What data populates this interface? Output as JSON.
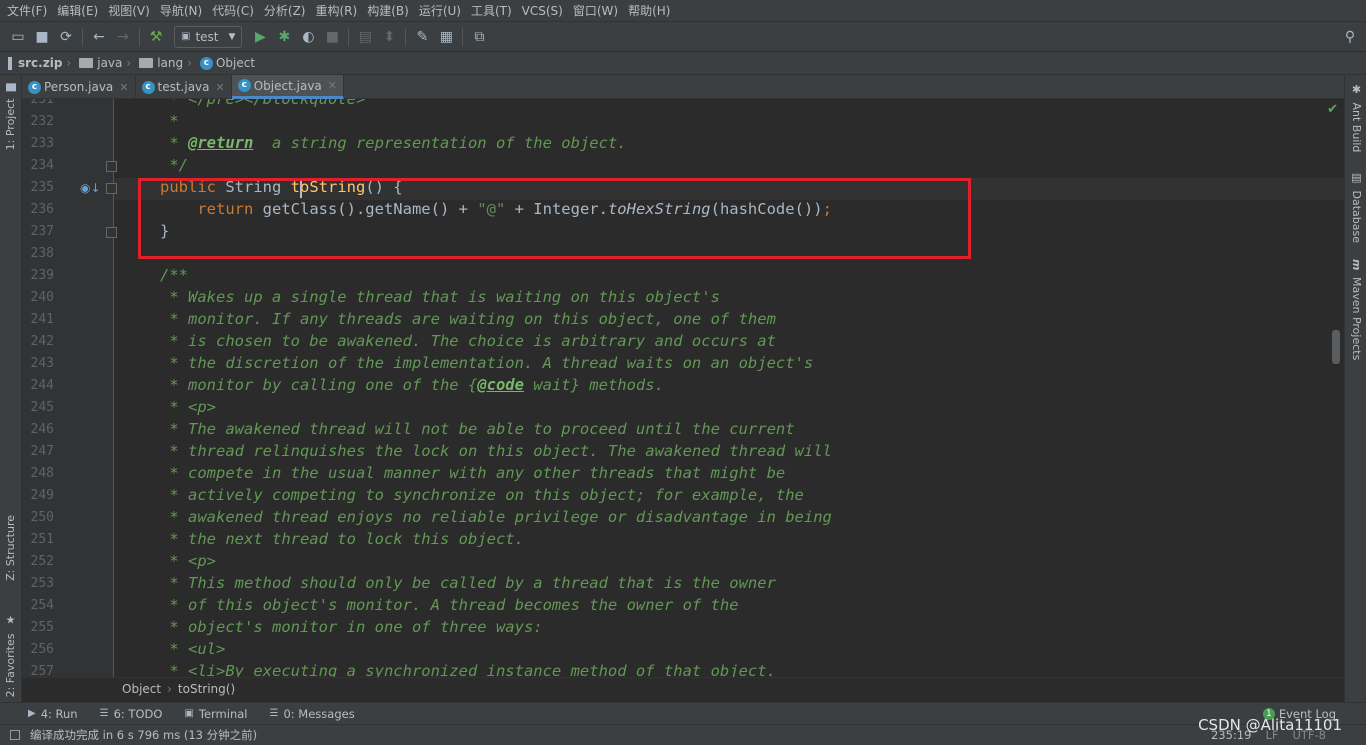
{
  "menu": [
    "文件(F)",
    "编辑(E)",
    "视图(V)",
    "导航(N)",
    "代码(C)",
    "分析(Z)",
    "重构(R)",
    "构建(B)",
    "运行(U)",
    "工具(T)",
    "VCS(S)",
    "窗口(W)",
    "帮助(H)"
  ],
  "toolbar": {
    "run_config": "test"
  },
  "navbar": {
    "items": [
      "src.zip",
      "java",
      "lang",
      "Object"
    ]
  },
  "tabs": [
    {
      "label": "Person.java",
      "active": false
    },
    {
      "label": "test.java",
      "active": false
    },
    {
      "label": "Object.java",
      "active": true
    }
  ],
  "left_tools": {
    "project": "1: Project",
    "structure": "Z: Structure",
    "favorites": "2: Favorites"
  },
  "right_tools": {
    "ant": "Ant Build",
    "database": "Database",
    "maven": "Maven Projects"
  },
  "editor": {
    "line_numbers": [
      "231",
      "232",
      "233",
      "234",
      "235",
      "236",
      "237",
      "238",
      "239",
      "240",
      "241",
      "242",
      "243",
      "244",
      "245",
      "246",
      "247",
      "248",
      "249",
      "250",
      "251",
      "252",
      "253",
      "254",
      "255",
      "256",
      "257"
    ],
    "lines": [
      {
        "parts": [
          {
            "t": " * </pre></blockquote>",
            "c": "doc"
          }
        ]
      },
      {
        "parts": [
          {
            "t": " *",
            "c": "doc"
          }
        ]
      },
      {
        "parts": [
          {
            "t": " * ",
            "c": "doc"
          },
          {
            "t": "@return",
            "c": "tag"
          },
          {
            "t": "  a string representation of the object.",
            "c": "doc"
          }
        ]
      },
      {
        "parts": [
          {
            "t": " */",
            "c": "doc"
          }
        ]
      },
      {
        "parts": [
          {
            "t": "public ",
            "c": "kw"
          },
          {
            "t": "String ",
            "c": "pl"
          },
          {
            "t": "toString",
            "c": "fn"
          },
          {
            "t": "() {",
            "c": "pl"
          }
        ]
      },
      {
        "parts": [
          {
            "t": "    return ",
            "c": "kw"
          },
          {
            "t": "getClass().getName() + ",
            "c": "pl"
          },
          {
            "t": "\"@\"",
            "c": "str"
          },
          {
            "t": " + Integer.",
            "c": "pl"
          },
          {
            "t": "toHexString",
            "c": "it"
          },
          {
            "t": "(hashCode())",
            "c": "pl"
          },
          {
            "t": ";",
            "c": "kw"
          }
        ]
      },
      {
        "parts": [
          {
            "t": "}",
            "c": "pl"
          }
        ]
      },
      {
        "parts": [
          {
            "t": "",
            "c": "pl"
          }
        ]
      },
      {
        "parts": [
          {
            "t": "/**",
            "c": "doc"
          }
        ]
      },
      {
        "parts": [
          {
            "t": " * Wakes up a single thread that is waiting on this object's",
            "c": "doc"
          }
        ]
      },
      {
        "parts": [
          {
            "t": " * monitor. If any threads are waiting on this object, one of them",
            "c": "doc"
          }
        ]
      },
      {
        "parts": [
          {
            "t": " * is chosen to be awakened. The choice is arbitrary and occurs at",
            "c": "doc"
          }
        ]
      },
      {
        "parts": [
          {
            "t": " * the discretion of the implementation. A thread waits on an object's",
            "c": "doc"
          }
        ]
      },
      {
        "parts": [
          {
            "t": " * monitor by calling one of the {",
            "c": "doc"
          },
          {
            "t": "@code",
            "c": "tag"
          },
          {
            "t": " wait} methods.",
            "c": "doc"
          }
        ]
      },
      {
        "parts": [
          {
            "t": " * <p>",
            "c": "doc"
          }
        ]
      },
      {
        "parts": [
          {
            "t": " * The awakened thread will not be able to proceed until the current",
            "c": "doc"
          }
        ]
      },
      {
        "parts": [
          {
            "t": " * thread relinquishes the lock on this object. The awakened thread will",
            "c": "doc"
          }
        ]
      },
      {
        "parts": [
          {
            "t": " * compete in the usual manner with any other threads that might be",
            "c": "doc"
          }
        ]
      },
      {
        "parts": [
          {
            "t": " * actively competing to synchronize on this object; for example, the",
            "c": "doc"
          }
        ]
      },
      {
        "parts": [
          {
            "t": " * awakened thread enjoys no reliable privilege or disadvantage in being",
            "c": "doc"
          }
        ]
      },
      {
        "parts": [
          {
            "t": " * the next thread to lock this object.",
            "c": "doc"
          }
        ]
      },
      {
        "parts": [
          {
            "t": " * <p>",
            "c": "doc"
          }
        ]
      },
      {
        "parts": [
          {
            "t": " * This method should only be called by a thread that is the owner",
            "c": "doc"
          }
        ]
      },
      {
        "parts": [
          {
            "t": " * of this object's monitor. A thread becomes the owner of the",
            "c": "doc"
          }
        ]
      },
      {
        "parts": [
          {
            "t": " * object's monitor in one of three ways:",
            "c": "doc"
          }
        ]
      },
      {
        "parts": [
          {
            "t": " * <ul>",
            "c": "doc"
          }
        ]
      },
      {
        "parts": [
          {
            "t": " * <li>By executing a synchronized instance method of that object.",
            "c": "doc"
          }
        ]
      }
    ]
  },
  "breadcrumb": [
    "Object",
    "toString()"
  ],
  "toolwindows": [
    {
      "icon": "▶",
      "label": "4: Run"
    },
    {
      "icon": "☰",
      "label": "6: TODO"
    },
    {
      "icon": "▣",
      "label": "Terminal"
    },
    {
      "icon": "☰",
      "label": "0: Messages"
    }
  ],
  "event_log": {
    "count": "1",
    "label": "Event Log"
  },
  "status": {
    "message": "编译成功完成 in 6 s 796 ms (13 分钟之前)",
    "position": "235:19",
    "line_sep": "LF",
    "encoding": "UTF-8",
    "watermark": "CSDN @Alita11101"
  }
}
